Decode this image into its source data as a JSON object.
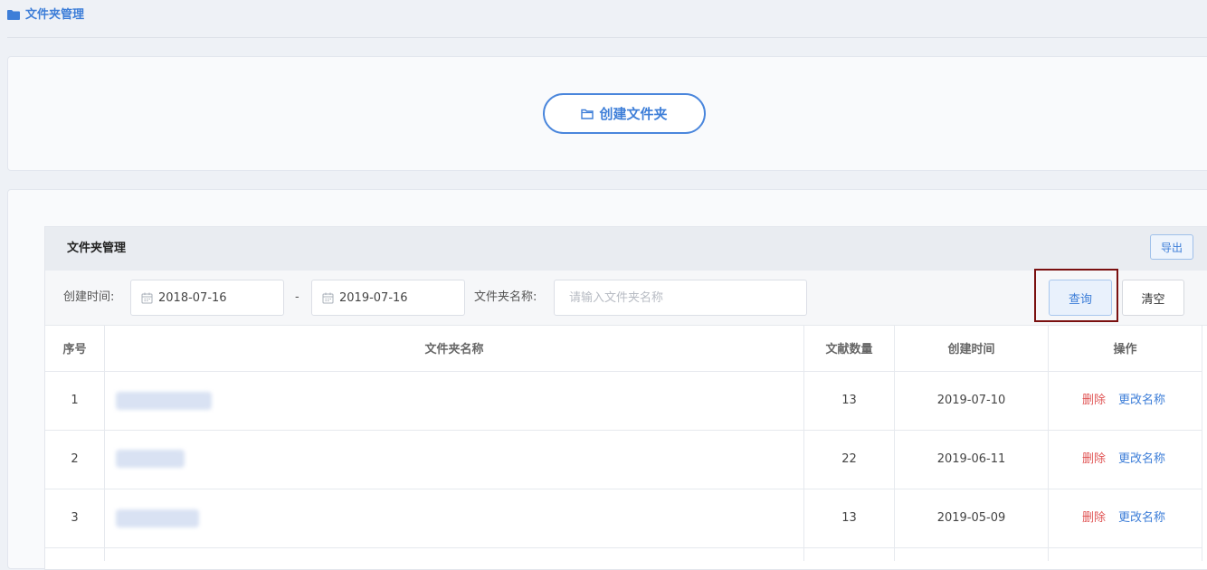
{
  "header": {
    "title": "文件夹管理",
    "icon": "folder-icon"
  },
  "create": {
    "label": "创建文件夹",
    "icon": "folder-outline-icon"
  },
  "card": {
    "title": "文件夹管理",
    "export_label": "导出"
  },
  "filter": {
    "created_label": "创建时间:",
    "start_date": "2018-07-16",
    "separator": "-",
    "end_date": "2019-07-16",
    "name_label": "文件夹名称:",
    "name_placeholder": "请输入文件夹名称",
    "query_label": "查询",
    "clear_label": "清空"
  },
  "table": {
    "columns": [
      "序号",
      "文件夹名称",
      "文献数量",
      "创建时间",
      "操作"
    ],
    "rows": [
      {
        "index": "1",
        "count": "13",
        "date": "2019-07-10",
        "delete": "删除",
        "rename": "更改名称"
      },
      {
        "index": "2",
        "count": "22",
        "date": "2019-06-11",
        "delete": "删除",
        "rename": "更改名称"
      },
      {
        "index": "3",
        "count": "13",
        "date": "2019-05-09",
        "delete": "删除",
        "rename": "更改名称"
      }
    ]
  },
  "colors": {
    "accent": "#3d7ed8",
    "danger": "#e05555",
    "highlight_border": "#7a1010"
  }
}
